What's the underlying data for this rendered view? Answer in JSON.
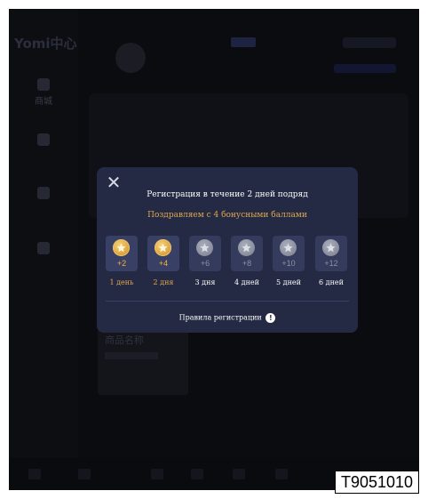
{
  "modal": {
    "title": "Регистрация в течение 2 дней подряд",
    "subtitle": "Поздравляем с 4 бонусными баллами",
    "days": [
      {
        "points": "+2",
        "label": "1 день",
        "claimed": true
      },
      {
        "points": "+4",
        "label": "2 дня",
        "claimed": true
      },
      {
        "points": "+6",
        "label": "3 дня",
        "claimed": false
      },
      {
        "points": "+8",
        "label": "4 дней",
        "claimed": false
      },
      {
        "points": "+10",
        "label": "5 дней",
        "claimed": false
      },
      {
        "points": "+12",
        "label": "6 дней",
        "claimed": false
      }
    ],
    "rules_label": "Правила регистрации",
    "info_icon_glyph": "!",
    "close_glyph": "✕"
  },
  "background": {
    "logo": "Yomi中心",
    "nav": [
      "商城"
    ],
    "product_title": "商品名称"
  },
  "code_label": "T9051010",
  "colors": {
    "modal_bg": "#252a44",
    "gold": "#e0a74d",
    "coin_gold": "#f2c15f",
    "coin_gray": "#8c91a6"
  }
}
